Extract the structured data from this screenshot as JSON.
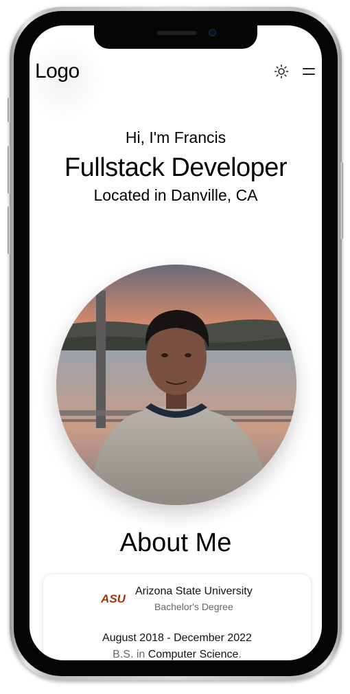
{
  "header": {
    "logo_text": "Logo",
    "theme_icon": "sun-icon",
    "menu_icon": "menu-icon"
  },
  "hero": {
    "greeting": "Hi, I'm Francis",
    "role": "Fullstack Developer",
    "location": "Located in Danville, CA"
  },
  "about": {
    "title": "About Me",
    "education": {
      "logo_text": "ASU",
      "school": "Arizona State University",
      "degree_type": "Bachelor's Degree",
      "dates": "August 2018 - December 2022",
      "degree_prefix": "B.S. in",
      "field": "Computer Science",
      "suffix": "."
    }
  },
  "colors": {
    "asu_maroon": "#8C1D40",
    "asu_gold": "#FFC627"
  }
}
